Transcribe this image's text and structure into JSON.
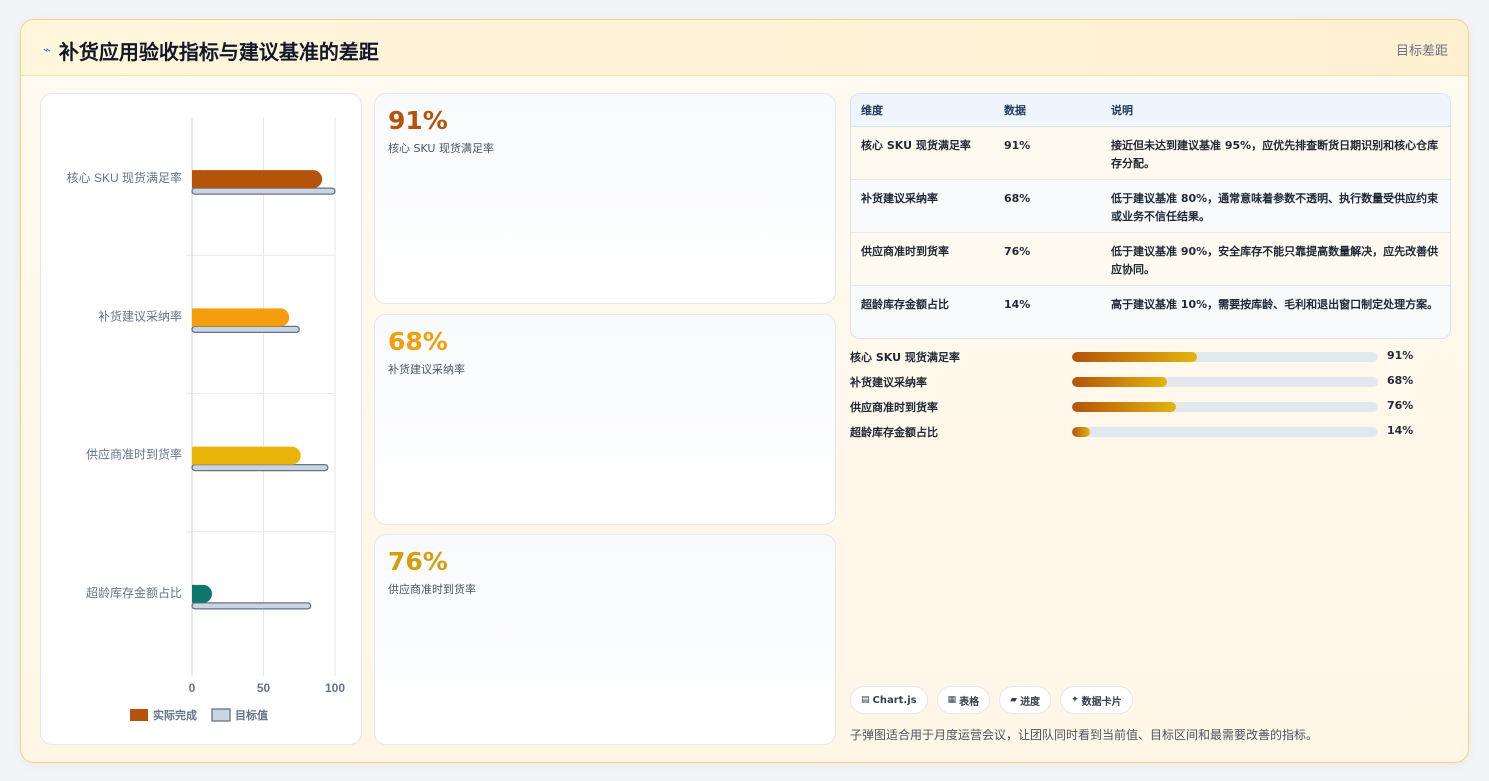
{
  "header": {
    "icon": "trend-line-icon",
    "title": "补货应用验收指标与建议基准的差距",
    "tag": "目标差距"
  },
  "chart_data": {
    "type": "bar",
    "orientation": "horizontal",
    "categories": [
      "核心 SKU 现货满足率",
      "补货建议采纳率",
      "供应商准时到货率",
      "超龄库存金额占比"
    ],
    "series": [
      {
        "name": "实际完成",
        "values": [
          91,
          68,
          76,
          14
        ],
        "colors": [
          "#b45309",
          "#f59e0b",
          "#eab308",
          "#0f766e"
        ]
      },
      {
        "name": "目标值",
        "values": [
          100,
          75,
          95,
          83
        ],
        "color": "#cbd5e1"
      }
    ],
    "xlim": [
      0,
      100
    ],
    "xticks": [
      "0",
      "50",
      "100"
    ],
    "grid": true,
    "legend": "bottom"
  },
  "kpis": [
    {
      "value": "91%",
      "label": "核心 SKU 现货满足率",
      "color": "#b45309"
    },
    {
      "value": "68%",
      "label": "补货建议采纳率",
      "color": "#f59e0b"
    },
    {
      "value": "76%",
      "label": "供应商准时到货率",
      "color": "#d69e0b"
    }
  ],
  "table": {
    "headers": [
      "维度",
      "数据",
      "说明"
    ],
    "rows": [
      {
        "dimension": "核心 SKU 现货满足率",
        "value": "91%",
        "note": "接近但未达到建议基准 95%，应优先排查断货日期识别和核心仓库存分配。"
      },
      {
        "dimension": "补货建议采纳率",
        "value": "68%",
        "note": "低于建议基准 80%，通常意味着参数不透明、执行数量受供应约束或业务不信任结果。"
      },
      {
        "dimension": "供应商准时到货率",
        "value": "76%",
        "note": "低于建议基准 90%，安全库存不能只靠提高数量解决，应先改善供应协同。"
      },
      {
        "dimension": "超龄库存金额占比",
        "value": "14%",
        "note": "高于建议基准 10%，需要按库龄、毛利和退出窗口制定处理方案。"
      }
    ]
  },
  "progress": [
    {
      "label": "核心 SKU 现货满足率",
      "value": "91%",
      "ratio": 0.41
    },
    {
      "label": "补货建议采纳率",
      "value": "68%",
      "ratio": 0.31
    },
    {
      "label": "供应商准时到货率",
      "value": "76%",
      "ratio": 0.34
    },
    {
      "label": "超龄库存金额占比",
      "value": "14%",
      "ratio": 0.06
    }
  ],
  "chips": [
    {
      "icon": "▤",
      "label": "Chart.js"
    },
    {
      "icon": "▦",
      "label": "表格"
    },
    {
      "icon": "▰",
      "label": "进度"
    },
    {
      "icon": "✦",
      "label": "数据卡片"
    }
  ],
  "footer": {
    "note": "子弹图适合用于月度运营会议，让团队同时看到当前值、目标区间和最需要改善的指标。"
  }
}
